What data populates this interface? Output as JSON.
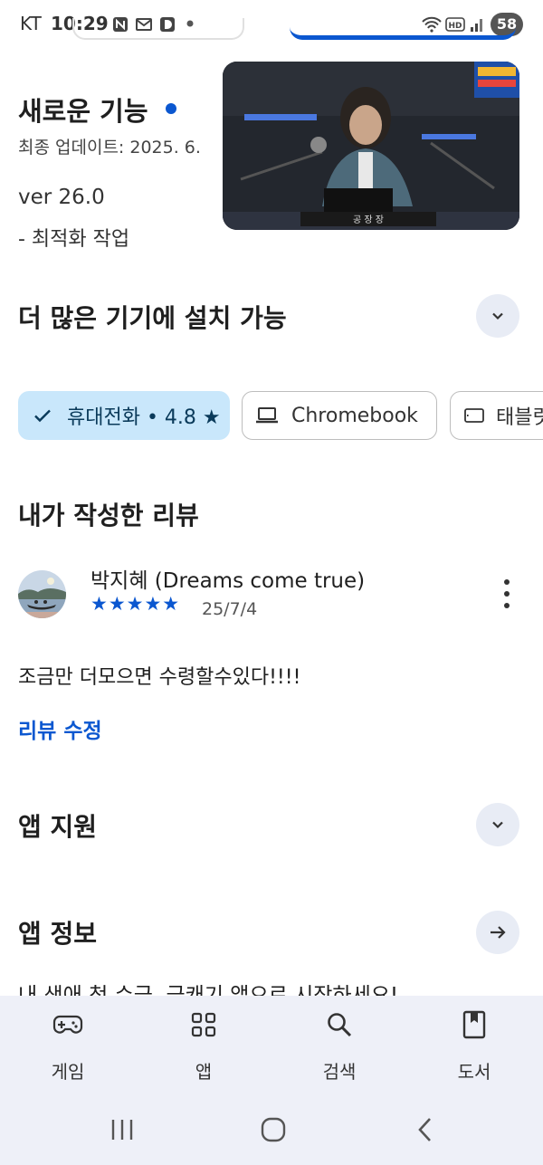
{
  "status_bar": {
    "carrier": "KT",
    "time": "10:29",
    "battery": "58",
    "icons": [
      "n-icon",
      "mail-icon",
      "d-icon",
      "dot-icon",
      "wifi-icon",
      "hd-icon",
      "signal-icon"
    ]
  },
  "whats_new": {
    "title": "새로운 기능",
    "updated": "최종 업데이트: 2025. 6.",
    "version": "ver 26.0",
    "note": "- 최적화 작업",
    "video_sign": "공 장 장"
  },
  "devices": {
    "title": "더 많은 기기에 설치 가능",
    "chips": [
      {
        "label": "휴대전화 • 4.8 ★",
        "selected": true,
        "icon": "check-icon"
      },
      {
        "label": "Chromebook",
        "selected": false,
        "icon": "laptop-icon"
      },
      {
        "label": "태블릿",
        "selected": false,
        "icon": "tablet-icon"
      }
    ]
  },
  "my_review": {
    "title": "내가 작성한 리뷰",
    "reviewer": "박지혜 (Dreams come true)",
    "stars": "★★★★★",
    "rating": 5,
    "date": "25/7/4",
    "text": "조금만 더모으면 수령할수있다!!!!",
    "edit_label": "리뷰 수정"
  },
  "app_support": {
    "title": "앱 지원"
  },
  "app_info": {
    "title": "앱 정보",
    "cut_text": "내 생애 첫 수금, 금캐기 앱으로 시작하세요!"
  },
  "bottom_nav": {
    "items": [
      {
        "label": "게임",
        "icon": "gamepad-icon"
      },
      {
        "label": "앱",
        "icon": "apps-grid-icon"
      },
      {
        "label": "검색",
        "icon": "search-icon"
      },
      {
        "label": "도서",
        "icon": "book-icon"
      }
    ]
  },
  "colors": {
    "accent": "#0b57d0",
    "chip_selected_bg": "#c9e7fb",
    "nav_bg": "#eef0f8",
    "round_button_bg": "#e8ecf5"
  }
}
